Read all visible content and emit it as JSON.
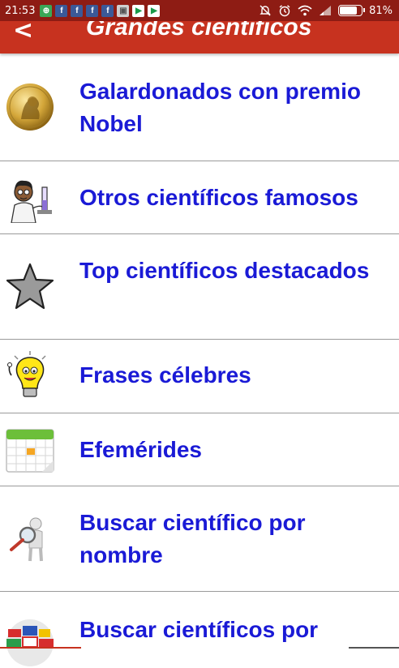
{
  "status_bar": {
    "time": "21:53",
    "notif_icons": [
      "f",
      "f",
      "f",
      "f"
    ],
    "battery_pct": 0.81,
    "battery_label": "81%"
  },
  "app_bar": {
    "back_label": "<",
    "title": "Grandes científicos"
  },
  "menu": {
    "items": [
      {
        "label": "Galardonados con premio Nobel",
        "icon": "nobel-medal-icon"
      },
      {
        "label": "Otros científicos famosos",
        "icon": "scientist-icon"
      },
      {
        "label": "Top científicos destacados",
        "icon": "star-icon"
      },
      {
        "label": "Frases célebres",
        "icon": "lightbulb-icon"
      },
      {
        "label": "Efemérides",
        "icon": "calendar-icon"
      },
      {
        "label": "Buscar científico por nombre",
        "icon": "magnifier-icon"
      },
      {
        "label": "Buscar científicos por",
        "icon": "globe-flags-icon"
      }
    ]
  },
  "colors": {
    "app_bar": "#c7321f",
    "status_bar": "#8e1c14",
    "link_text": "#1a1ad6"
  }
}
